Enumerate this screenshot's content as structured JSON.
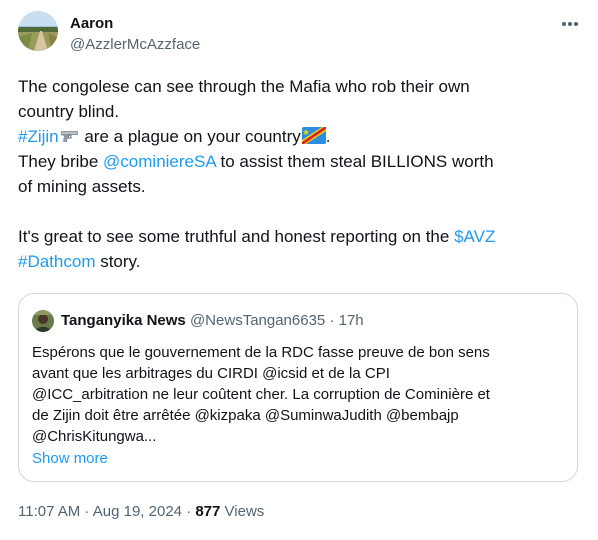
{
  "author": {
    "name": "Aaron",
    "handle": "@AzzlerMcAzzface",
    "avatar_icon": "landscape-road-avatar"
  },
  "menu": {
    "more_icon": "more-horizontal-icon"
  },
  "tweet": {
    "line1": "The congolese can see through the Mafia who rob their own",
    "line2": "country blind.",
    "hashtag_zijin": "#Zijin",
    "line3_rest": " are a plague on your country",
    "line3_end": ".",
    "line4_start": "They bribe ",
    "mention_cominiere": "@cominiereSA",
    "line4_end": " to assist them steal BILLIONS worth",
    "line5": "of mining assets.",
    "line6_start": "It's great to see some truthful and honest reporting on the ",
    "cashtag_avz": "$AVZ",
    "hashtag_dathcom": "#Dathcom",
    "line7_end": " story.",
    "emojis": [
      "pistol-icon",
      "drc-flag-icon"
    ]
  },
  "quote": {
    "name": "Tanganyika News",
    "handle_time": "@NewsTangan6635 · 17h",
    "lines": [
      "Espérons que le gouvernement de la RDC fasse preuve de bon sens",
      "avant que les arbitrages du CIRDI @icsid et de la CPI",
      "@ICC_arbitration ne leur coûtent cher. La corruption de Cominière et",
      "de Zijin doit être arrêtée @kizpaka @SuminwaJudith @bembajp",
      "@ChrisKitungwa..."
    ],
    "show_more": "Show more"
  },
  "footer": {
    "timestamp": "11:07 AM · Aug 19, 2024 · ",
    "views_count": "877",
    "views_label": " Views"
  },
  "colors": {
    "text": "#0f1419",
    "secondary": "#536471",
    "link": "#1d9bf0",
    "border": "#cfd9de"
  }
}
